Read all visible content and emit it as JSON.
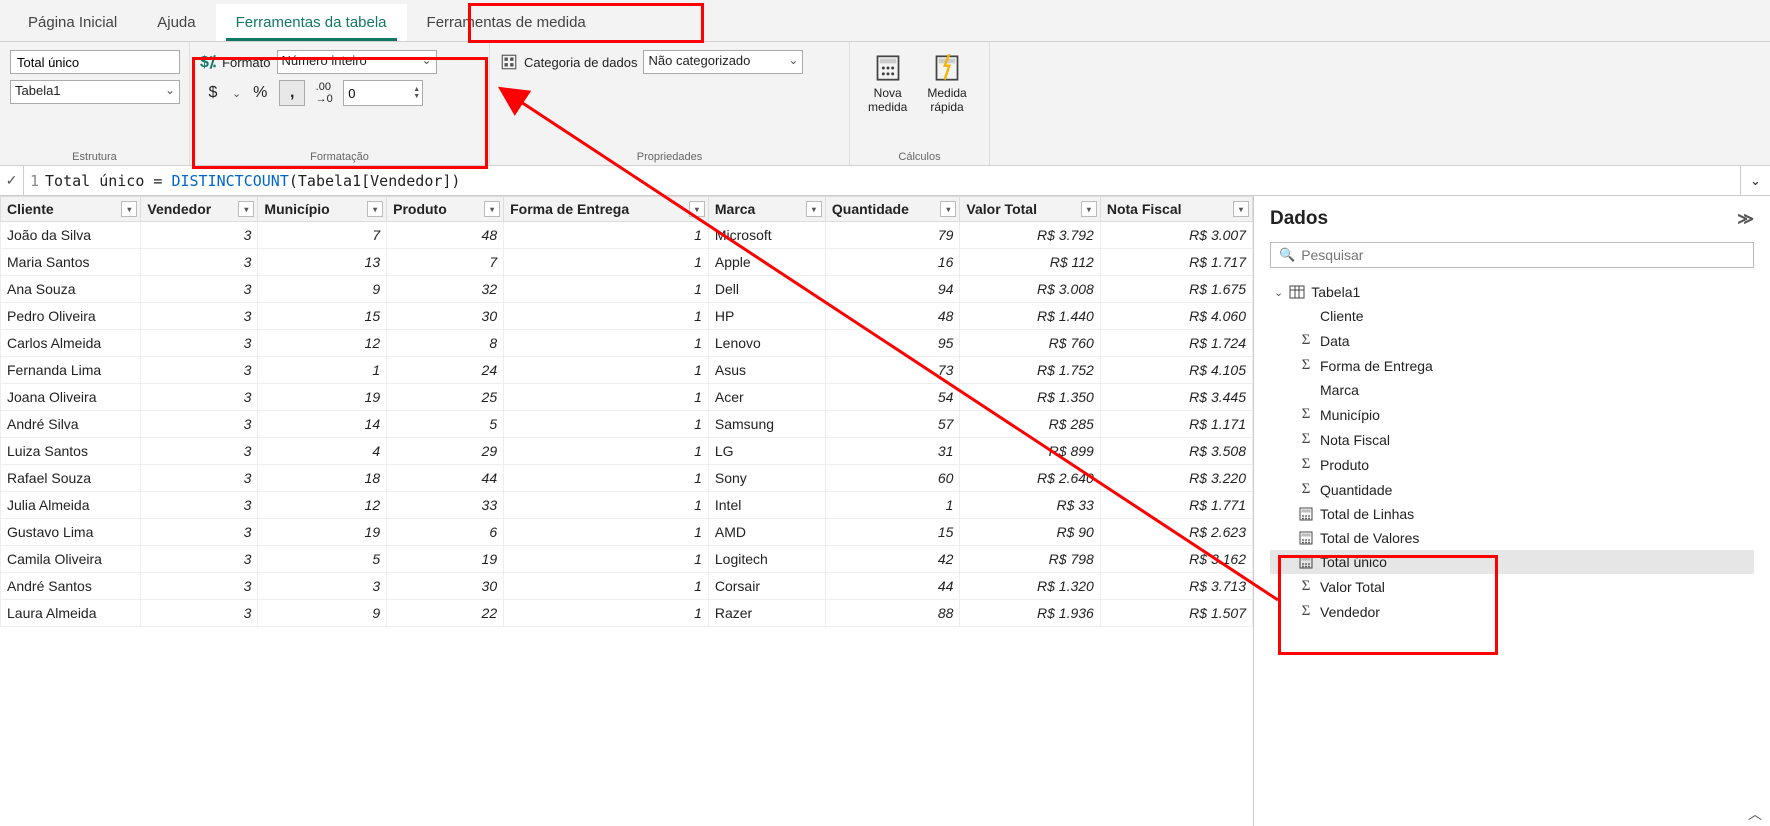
{
  "tabs": {
    "home": "Página Inicial",
    "help": "Ajuda",
    "tabletools": "Ferramentas da tabela",
    "measuretools": "Ferramentas de medida"
  },
  "structure": {
    "name_value": "Total único",
    "table_value": "Tabela1",
    "group_label": "Estrutura"
  },
  "format": {
    "label": "Formato",
    "select_value": "Número inteiro",
    "decimals_value": "0",
    "group_label": "Formatação"
  },
  "properties": {
    "label": "Categoria de dados",
    "select_value": "Não categorizado",
    "group_label": "Propriedades"
  },
  "calc": {
    "new_measure_l1": "Nova",
    "new_measure_l2": "medida",
    "quick_measure_l1": "Medida",
    "quick_measure_l2": "rápida",
    "group_label": "Cálculos"
  },
  "formula": {
    "line": "1",
    "prefix": "Total único = ",
    "func": "DISTINCTCOUNT",
    "suffix": "(Tabela1[Vendedor])"
  },
  "columns": [
    "Cliente",
    "Vendedor",
    "Município",
    "Produto",
    "Forma de Entrega",
    "Marca",
    "Quantidade",
    "Valor Total",
    "Nota Fiscal"
  ],
  "rows": [
    {
      "c": "João da Silva",
      "v": "3",
      "m": "7",
      "p": "48",
      "f": "1",
      "ma": "Microsoft",
      "q": "79",
      "vt": "R$ 3.792",
      "nf": "R$ 3.007"
    },
    {
      "c": "Maria Santos",
      "v": "3",
      "m": "13",
      "p": "7",
      "f": "1",
      "ma": "Apple",
      "q": "16",
      "vt": "R$ 112",
      "nf": "R$ 1.717"
    },
    {
      "c": "Ana Souza",
      "v": "3",
      "m": "9",
      "p": "32",
      "f": "1",
      "ma": "Dell",
      "q": "94",
      "vt": "R$ 3.008",
      "nf": "R$ 1.675"
    },
    {
      "c": "Pedro Oliveira",
      "v": "3",
      "m": "15",
      "p": "30",
      "f": "1",
      "ma": "HP",
      "q": "48",
      "vt": "R$ 1.440",
      "nf": "R$ 4.060"
    },
    {
      "c": "Carlos Almeida",
      "v": "3",
      "m": "12",
      "p": "8",
      "f": "1",
      "ma": "Lenovo",
      "q": "95",
      "vt": "R$ 760",
      "nf": "R$ 1.724"
    },
    {
      "c": "Fernanda Lima",
      "v": "3",
      "m": "1",
      "p": "24",
      "f": "1",
      "ma": "Asus",
      "q": "73",
      "vt": "R$ 1.752",
      "nf": "R$ 4.105"
    },
    {
      "c": "Joana Oliveira",
      "v": "3",
      "m": "19",
      "p": "25",
      "f": "1",
      "ma": "Acer",
      "q": "54",
      "vt": "R$ 1.350",
      "nf": "R$ 3.445"
    },
    {
      "c": "André Silva",
      "v": "3",
      "m": "14",
      "p": "5",
      "f": "1",
      "ma": "Samsung",
      "q": "57",
      "vt": "R$ 285",
      "nf": "R$ 1.171"
    },
    {
      "c": "Luiza Santos",
      "v": "3",
      "m": "4",
      "p": "29",
      "f": "1",
      "ma": "LG",
      "q": "31",
      "vt": "R$ 899",
      "nf": "R$ 3.508"
    },
    {
      "c": "Rafael Souza",
      "v": "3",
      "m": "18",
      "p": "44",
      "f": "1",
      "ma": "Sony",
      "q": "60",
      "vt": "R$ 2.640",
      "nf": "R$ 3.220"
    },
    {
      "c": "Julia Almeida",
      "v": "3",
      "m": "12",
      "p": "33",
      "f": "1",
      "ma": "Intel",
      "q": "1",
      "vt": "R$ 33",
      "nf": "R$ 1.771"
    },
    {
      "c": "Gustavo Lima",
      "v": "3",
      "m": "19",
      "p": "6",
      "f": "1",
      "ma": "AMD",
      "q": "15",
      "vt": "R$ 90",
      "nf": "R$ 2.623"
    },
    {
      "c": "Camila Oliveira",
      "v": "3",
      "m": "5",
      "p": "19",
      "f": "1",
      "ma": "Logitech",
      "q": "42",
      "vt": "R$ 798",
      "nf": "R$ 3.162"
    },
    {
      "c": "André Santos",
      "v": "3",
      "m": "3",
      "p": "30",
      "f": "1",
      "ma": "Corsair",
      "q": "44",
      "vt": "R$ 1.320",
      "nf": "R$ 3.713"
    },
    {
      "c": "Laura Almeida",
      "v": "3",
      "m": "9",
      "p": "22",
      "f": "1",
      "ma": "Razer",
      "q": "88",
      "vt": "R$ 1.936",
      "nf": "R$ 1.507"
    }
  ],
  "fields": {
    "title": "Dados",
    "search_placeholder": "Pesquisar",
    "table": "Tabela1",
    "items": [
      {
        "label": "Cliente",
        "type": "text"
      },
      {
        "label": "Data",
        "type": "sigma"
      },
      {
        "label": "Forma de Entrega",
        "type": "sigma"
      },
      {
        "label": "Marca",
        "type": "text"
      },
      {
        "label": "Município",
        "type": "sigma"
      },
      {
        "label": "Nota Fiscal",
        "type": "sigma"
      },
      {
        "label": "Produto",
        "type": "sigma"
      },
      {
        "label": "Quantidade",
        "type": "sigma"
      },
      {
        "label": "Total de Linhas",
        "type": "measure"
      },
      {
        "label": "Total de Valores",
        "type": "measure"
      },
      {
        "label": "Total único",
        "type": "measure",
        "selected": true
      },
      {
        "label": "Valor Total",
        "type": "sigma"
      },
      {
        "label": "Vendedor",
        "type": "sigma"
      }
    ]
  }
}
